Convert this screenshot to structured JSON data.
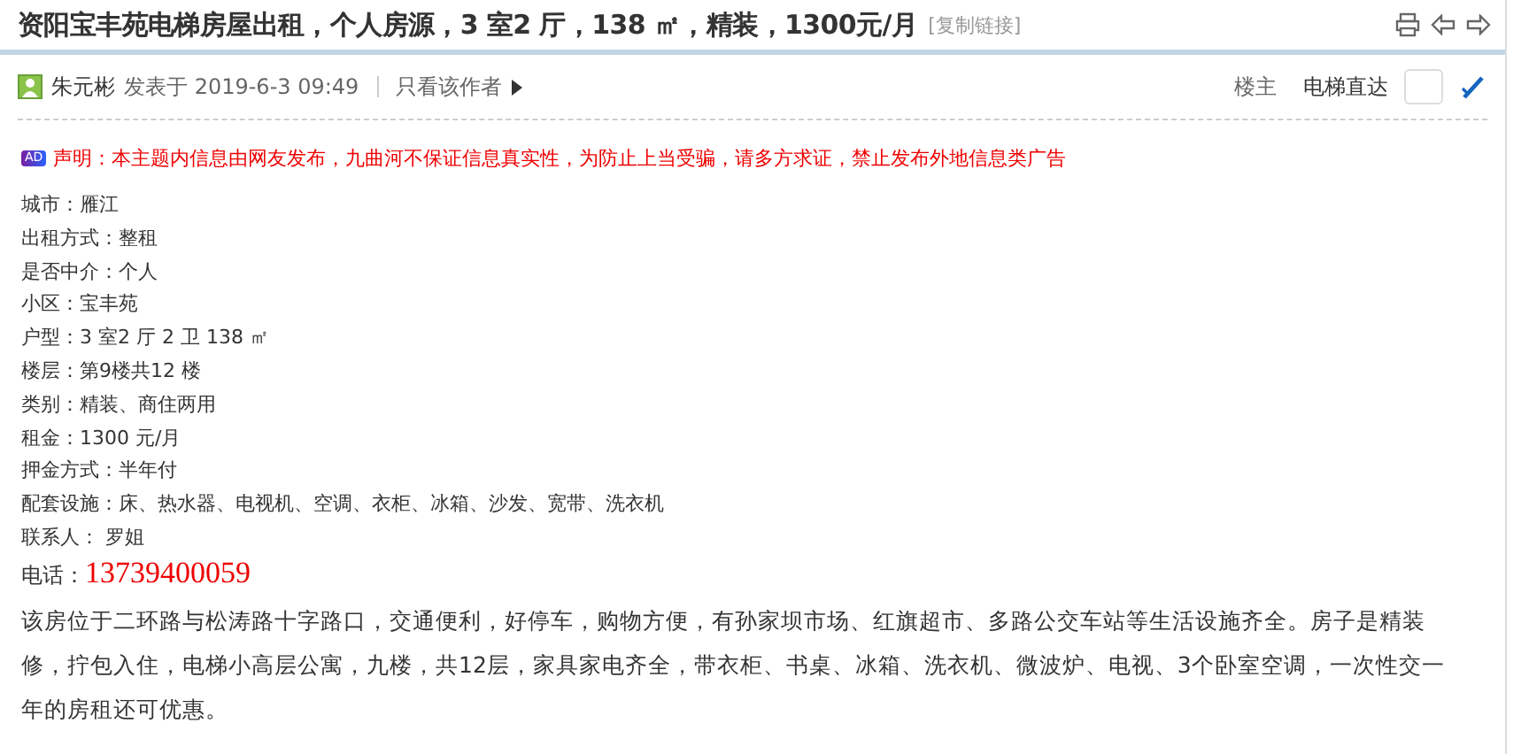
{
  "title": "资阳宝丰苑电梯房屋出租，个人房源，3 室2 厅，138 ㎡，精装，1300元/月",
  "copy_link": "[复制链接]",
  "post": {
    "author": "朱元彬",
    "posted": "发表于 2019-6-3 09:49",
    "only_author": "只看该作者",
    "floor": "楼主",
    "jump": "电梯直达"
  },
  "notice": {
    "badge": "AD",
    "text": "声明：本主题内信息由网友发布，九曲河不保证信息真实性，为防止上当受骗，请多方求证，禁止发布外地信息类广告"
  },
  "fields": [
    {
      "label": "城市：",
      "value": "雁江"
    },
    {
      "label": "出租方式：",
      "value": "整租"
    },
    {
      "label": "是否中介：",
      "value": "个人"
    },
    {
      "label": "小区：",
      "value": "宝丰苑"
    },
    {
      "label": "户型：",
      "value": "3 室2 厅 2 卫 138 ㎡"
    },
    {
      "label": "楼层：",
      "value": "第9楼共12 楼"
    },
    {
      "label": "类别：",
      "value": "精装、商住两用"
    },
    {
      "label": "租金：",
      "value": "1300 元/月"
    },
    {
      "label": "押金方式：",
      "value": "半年付"
    },
    {
      "label": "配套设施：",
      "value": "床、热水器、电视机、空调、衣柜、冰箱、沙发、宽带、洗衣机"
    },
    {
      "label": "联系人：",
      "value": " 罗姐"
    }
  ],
  "phone": {
    "label": "电话：",
    "value": "13739400059"
  },
  "description": "该房位于二环路与松涛路十字路口，交通便利，好停车，购物方便，有孙家坝市场、红旗超市、多路公交车站等生活设施齐全。房子是精装修，拧包入住，电梯小高层公寓，九楼，共12层，家具家电齐全，带衣柜、书桌、冰箱、洗衣机、微波炉、电视、3个卧室空调，一次性交一年的房租还可优惠。"
}
